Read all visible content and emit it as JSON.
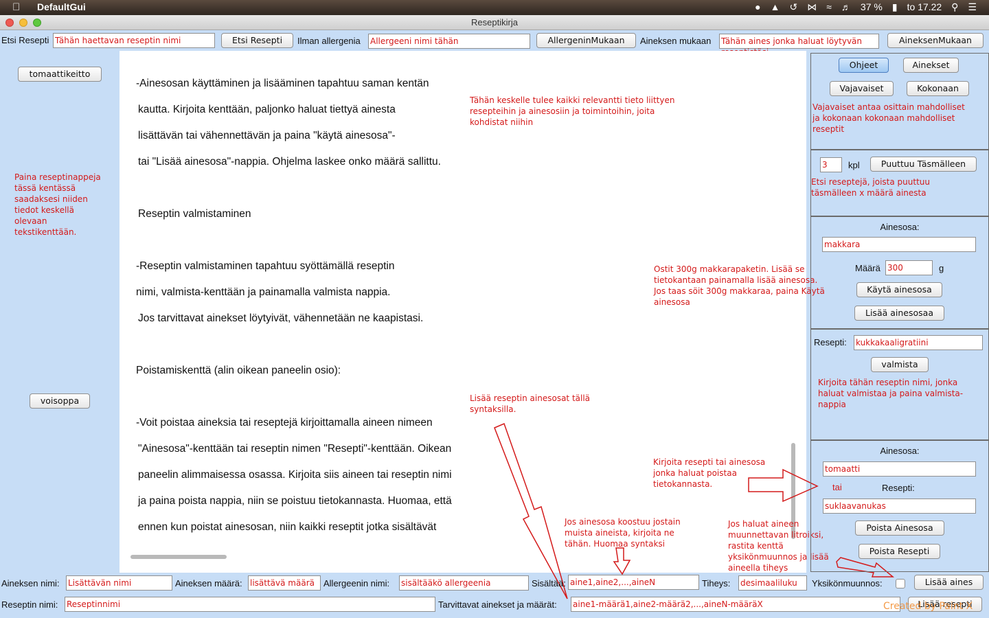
{
  "menubar": {
    "app_name": "DefaultGui",
    "battery": "37 %",
    "clock": "to 17.22"
  },
  "window": {
    "title": "Reseptikirja"
  },
  "toolbar": {
    "search_label": "Etsi Resepti",
    "search_placeholder": "Tähän haettavan reseptin nimi",
    "search_button": "Etsi Resepti",
    "allergy_label": "Ilman allergenia",
    "allergy_placeholder": "Allergeeni nimi tähän",
    "allergy_button": "AllergeninMukaan",
    "ingredient_label": "Aineksen mukaan",
    "ingredient_placeholder": "Tähän aines jonka haluat löytyvän",
    "ingredient_button": "AineksenMukaan",
    "ingredient_overflow_hint": "reseptistäsi"
  },
  "left_panel": {
    "recipe_buttons": [
      "tomaattikeitto",
      "voisoppa"
    ],
    "hint": [
      "Paina reseptinappeja",
      "tässä kentässä",
      "saadaksesi niiden",
      "tiedot keskellä",
      "olevaan",
      "tekstikenttään."
    ]
  },
  "main_text": {
    "lines": [
      "-Ainesosan käyttäminen ja lisääminen tapahtuu saman kentän",
      "kautta. Kirjoita kenttään, paljonko haluat tiettyä ainesta",
      "lisättävän tai vähennettävän ja paina \"käytä ainesosa\"-",
      "tai \"Lisää ainesosa\"-nappia. Ohjelma laskee onko määrä sallittu.",
      "Reseptin valmistaminen",
      "-Reseptin valmistaminen tapahtuu syöttämällä reseptin",
      "nimi, valmista-kenttään ja painamalla valmista nappia.",
      "Jos tarvittavat ainekset löytyivät, vähennetään ne kaapistasi.",
      "Poistamiskenttä (alin oikean paneelin osio):",
      "-Voit poistaa aineksia tai reseptejä kirjoittamalla aineen nimeen",
      "\"Ainesosa\"-kenttään tai reseptin nimen \"Resepti\"-kenttään. Oikean",
      "paneelin alimmaisessa osassa. Kirjoita siis aineen tai reseptin nimi",
      "ja paina poista nappia, niin se poistuu tietokannasta. Huomaa, että",
      "ennen kun poistat ainesosan, niin kaikki reseptit jotka sisältävät"
    ]
  },
  "annotations": {
    "center_info": [
      "Tähän keskelle tulee kaikki relevantti tieto liittyen",
      "resepteihin ja ainesosiin ja toimintoihin, joita",
      "kohdistat niihin"
    ],
    "sausage_example": [
      "Ostit 300g makkarapaketin. Lisää se",
      "tietokantaan painamalla lisää ainesosa.",
      "Jos taas söit 300g makkaraa, paina Käytä",
      "ainesosa"
    ],
    "add_ingredients_syntax": [
      "Lisää reseptin ainesosat tällä",
      "syntaksilla."
    ],
    "delete_hint": [
      "Kirjoita resepti tai ainesosa",
      "jonka haluat poistaa",
      "tietokannasta."
    ],
    "composite_hint": [
      "Jos ainesosa koostuu jostain",
      "muista aineista, kirjoita ne",
      "tähän.  Huomaa syntaksi"
    ],
    "unit_conversion_hint": [
      "Jos haluat aineen",
      "muunnettavan litroiksi,",
      "rastita kenttä",
      "yksikönmuunnos ja lisää",
      "aineella tiheys"
    ],
    "watermark": "Created by Paint X"
  },
  "right_panel": {
    "help_buttons": [
      "Ohjeet",
      "Ainekset",
      "Vajavaiset",
      "Kokonaan"
    ],
    "help_hint": [
      "Vajavaiset antaa osittain mahdolliset",
      "ja kokonaan kokonaan mahdolliset",
      "reseptit"
    ],
    "missing_count": "3",
    "missing_unit": "kpl",
    "missing_button": "Puuttuu Täsmälleen",
    "missing_hint": [
      "Etsi reseptejä, joista puuttuu",
      "täsmälleen x määrä ainesta"
    ],
    "ingredient_title": "Ainesosa:",
    "ingredient_value": "makkara",
    "amount_label": "Määrä",
    "amount_value": "300",
    "amount_unit": "g",
    "use_button": "Käytä ainesosa",
    "add_button": "Lisää ainesosaa",
    "recipe_label": "Resepti:",
    "recipe_value": "kukkakaaligratiini",
    "make_button": "valmista",
    "make_hint": [
      "Kirjoita tähän reseptin nimi, jonka",
      "haluat valmistaa ja paina valmista-",
      "nappia"
    ],
    "delete_ingredient_title": "Ainesosa:",
    "delete_ingredient_value": "tomaatti",
    "or_label": "tai",
    "delete_recipe_title": "Resepti:",
    "delete_recipe_value": "suklaavanukas",
    "delete_ingredient_button": "Poista Ainesosa",
    "delete_recipe_button": "Poista Resepti"
  },
  "bottom_bar": {
    "ingredient_name_label": "Aineksen nimi:",
    "ingredient_name_placeholder": "Lisättävän nimi",
    "ingredient_amount_label": "Aineksen määrä:",
    "ingredient_amount_placeholder": "lisättävä määrä",
    "allergen_label": "Allergeenin nimi:",
    "allergen_placeholder": "sisältääkö allergeenia",
    "contains_label": "Sisältää:",
    "contains_placeholder": "aine1,aine2,...,aineN",
    "density_label": "Tiheys:",
    "density_placeholder": "desimaaliluku",
    "unit_conversion_label": "Yksikönmuunnos:",
    "add_ingredient_button": "Lisää aines",
    "recipe_name_label": "Reseptin nimi:",
    "recipe_name_placeholder": "Reseptinnimi",
    "required_label": "Tarvittavat ainekset ja määrät:",
    "required_placeholder": "aine1-määrä1,aine2-määrä2,...,aineN-määräX",
    "add_recipe_button": "Lisää resepti"
  },
  "colors": {
    "accent": "#d41a1a",
    "background": "#c7ddf6",
    "button_default": "#9ec8f2"
  }
}
